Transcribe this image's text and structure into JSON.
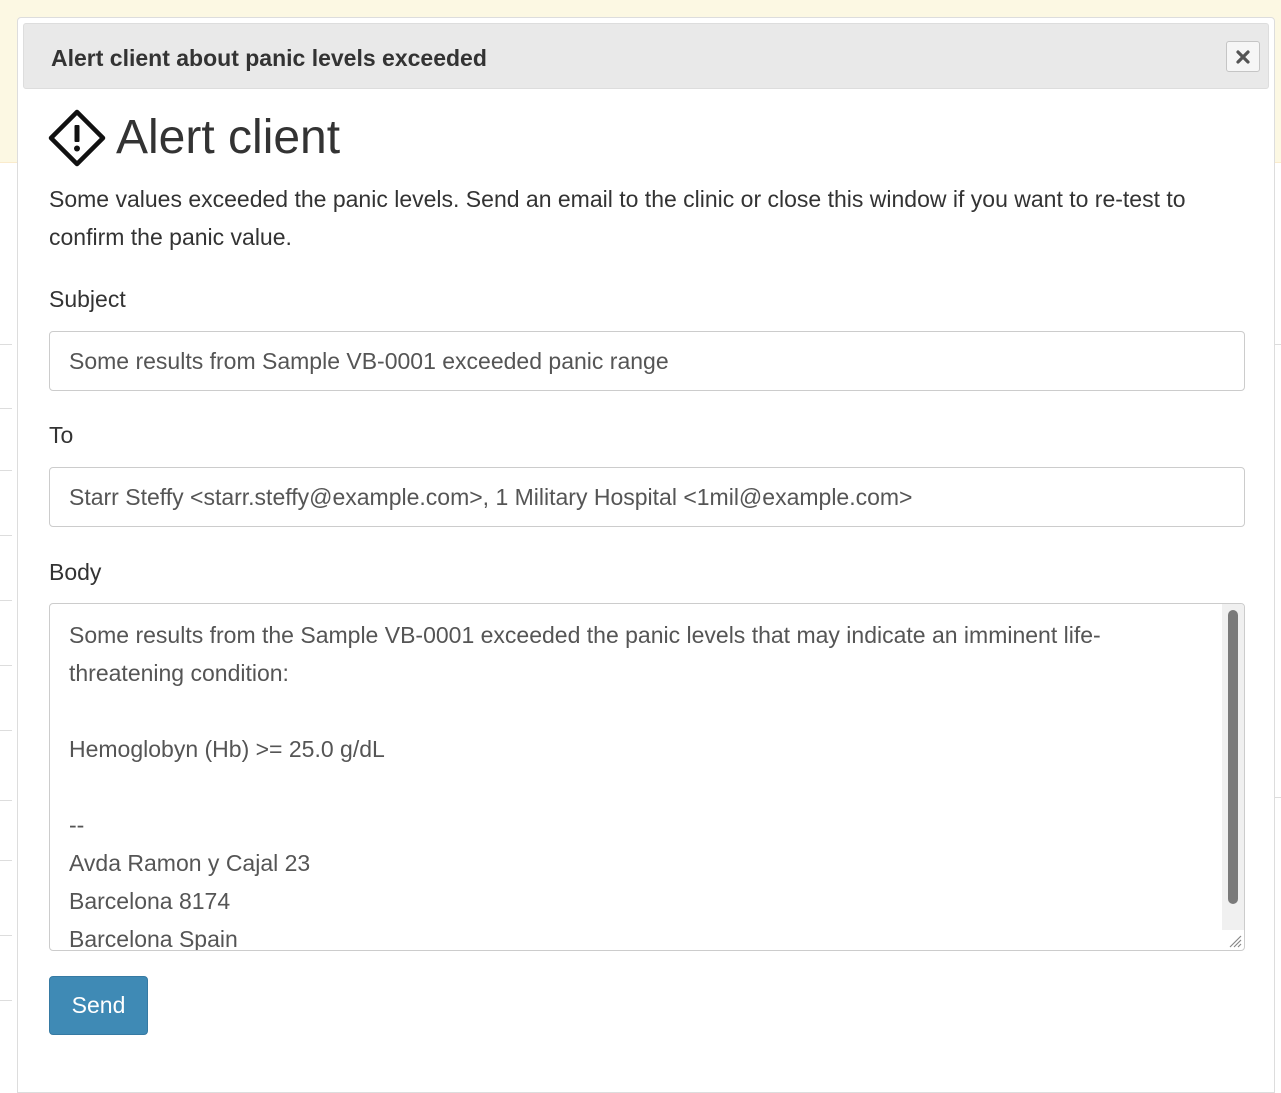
{
  "dialog": {
    "title": "Alert client about panic levels exceeded",
    "close_icon": "close-icon"
  },
  "heading": {
    "icon": "warning-diamond-icon",
    "text": "Alert client"
  },
  "intro": "Some values exceeded the panic levels. Send an email to the clinic or close this window if you want to re-test to confirm the panic value.",
  "form": {
    "subject_label": "Subject",
    "subject_value": "Some results from Sample VB-0001 exceeded panic range",
    "to_label": "To",
    "to_value": "Starr Steffy <starr.steffy@example.com>, 1 Military Hospital <1mil@example.com>",
    "body_label": "Body",
    "body_value": "Some results from the Sample VB-0001 exceeded the panic levels that may indicate an imminent life-threatening condition:\n\nHemoglobyn (Hb) >= 25.0 g/dL\n\n--\nAvda Ramon y Cajal 23\nBarcelona 8174\nBarcelona Spain",
    "send_label": "Send"
  },
  "colors": {
    "primary_button": "#3f8ab5",
    "titlebar": "#e9e9e9",
    "backdrop_warning": "#fcf8e3"
  }
}
